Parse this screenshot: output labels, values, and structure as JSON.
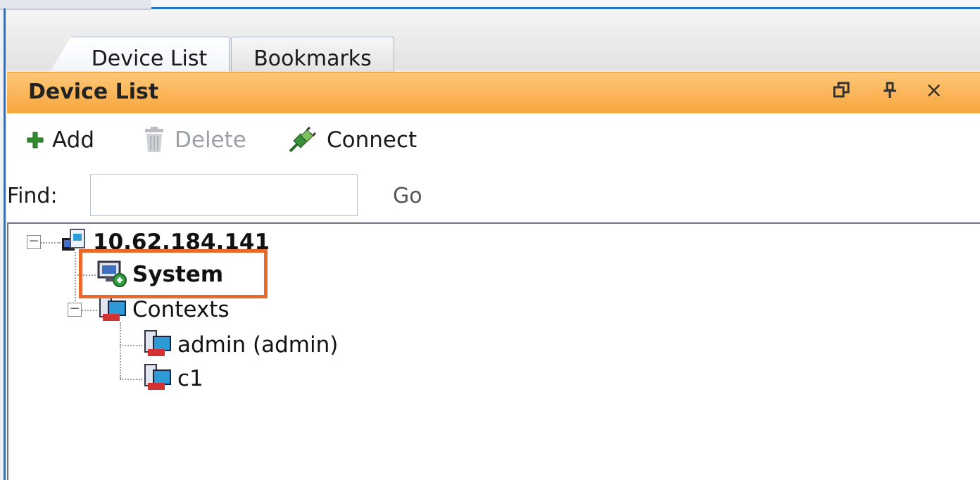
{
  "tabs": [
    {
      "label": "Device List",
      "active": true
    },
    {
      "label": "Bookmarks",
      "active": false
    }
  ],
  "panel": {
    "title": "Device List",
    "controls": {
      "restore": "restore-window-icon",
      "pin": "pin-icon",
      "close": "×"
    }
  },
  "toolbar": {
    "add_label": "Add",
    "delete_label": "Delete",
    "connect_label": "Connect"
  },
  "find": {
    "label": "Find:",
    "value": "",
    "go_label": "Go"
  },
  "tree": {
    "root": "10.62.184.141",
    "system": "System",
    "contexts": "Contexts",
    "children": [
      "admin (admin)",
      "c1"
    ]
  },
  "colors": {
    "accent_blue": "#1f73d1",
    "panel_orange": "#f6a53d",
    "highlight_orange": "#e8692a"
  }
}
